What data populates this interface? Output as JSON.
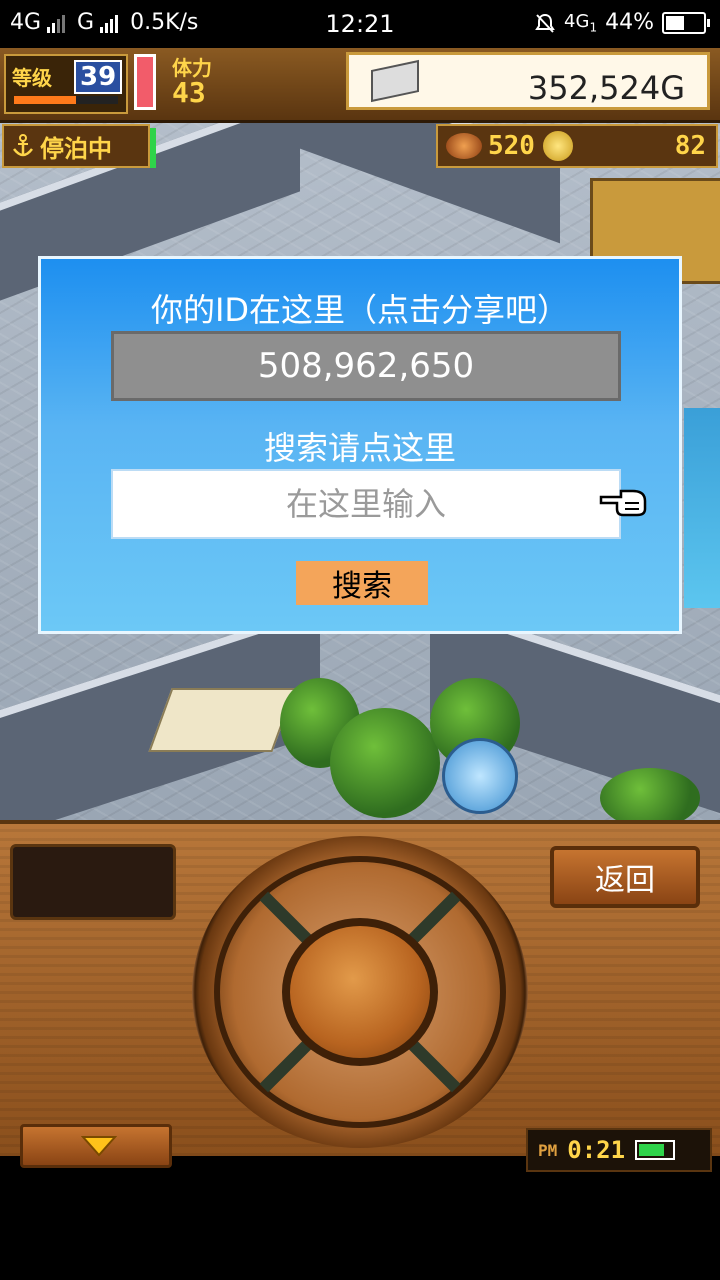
{
  "status_bar": {
    "network1": "4G",
    "network2": "G",
    "speed": "0.5K/s",
    "time": "12:21",
    "network3": "4G",
    "network3_sub": "1",
    "battery": "44%",
    "battery_level": 0.44
  },
  "hud": {
    "level_label": "等级",
    "level_value": "39",
    "level_progress": 0.6,
    "stamina_label": "体力",
    "stamina_value": "43",
    "gold": "352,524G",
    "anchor_status": "停泊中",
    "resource_food": "520",
    "resource_medals": "82"
  },
  "dialog": {
    "title": "你的ID在这里（点击分享吧）",
    "user_id": "508,962,650",
    "search_label": "搜索请点这里",
    "search_placeholder": "在这里输入",
    "search_button": "搜索"
  },
  "panel": {
    "back_button": "返回",
    "clock_ampm": "PM",
    "clock_time": "0:21",
    "clock_battery_level": 0.7
  },
  "colors": {
    "dialog_top": "#1d8ff0",
    "dialog_bottom": "#6cc8f6",
    "search_button": "#f4a55a",
    "id_box": "#8f8f8f",
    "hud_gold_text": "#ffd54a"
  }
}
